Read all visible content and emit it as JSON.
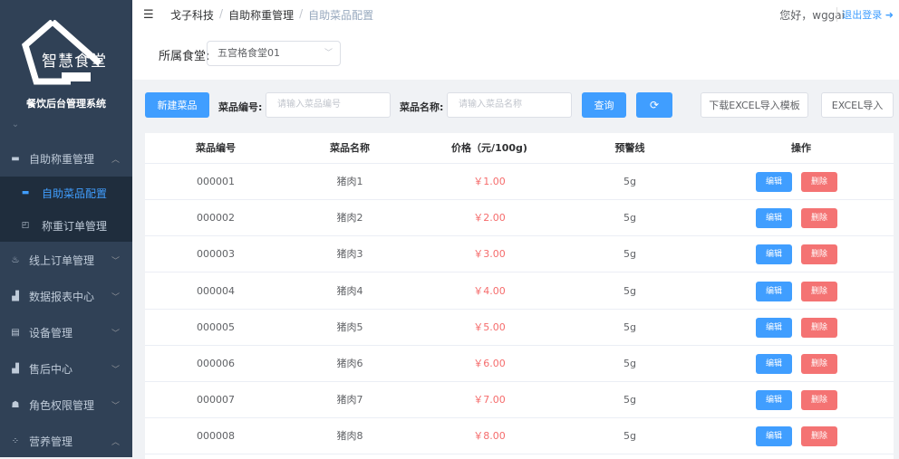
{
  "brand": {
    "logo_text": "智慧食堂",
    "system_title": "餐饮后台管理系统"
  },
  "colors": {
    "sidebar": "#304156",
    "submenu": "#1f2d3d",
    "primary": "#409eff",
    "danger": "#f56c6c",
    "danger_button": "#f47373"
  },
  "sidebar": {
    "items": [
      {
        "label": "自助称重管理",
        "icon": "scale-icon",
        "expanded": true
      },
      {
        "label": "线上订单管理",
        "icon": "food-icon"
      },
      {
        "label": "数据报表中心",
        "icon": "chart-icon"
      },
      {
        "label": "设备管理",
        "icon": "device-icon"
      },
      {
        "label": "售后中心",
        "icon": "chart-icon"
      },
      {
        "label": "角色权限管理",
        "icon": "users-icon"
      },
      {
        "label": "营养管理",
        "icon": "nutrition-icon",
        "expanded": true
      }
    ],
    "sub_items": [
      {
        "label": "自助菜品配置",
        "icon": "dish-icon",
        "active": true
      },
      {
        "label": "称重订单管理",
        "icon": "order-icon"
      }
    ]
  },
  "header": {
    "breadcrumb": [
      "戈子科技",
      "自助称重管理",
      "自助菜品配置"
    ],
    "greeting": "您好，wggai",
    "logout": "退出登录"
  },
  "canteen": {
    "label": "所属食堂:",
    "value": "五宫格食堂01"
  },
  "toolbar": {
    "new_label": "新建菜品",
    "code_label": "菜品编号:",
    "code_placeholder": "请输入菜品编号",
    "name_label": "菜品名称:",
    "name_placeholder": "请输入菜品名称",
    "query_label": "查询",
    "refresh_icon": "refresh-icon",
    "download_label": "下载EXCEL导入模板",
    "import_label": "EXCEL导入"
  },
  "table": {
    "columns": [
      "菜品编号",
      "菜品名称",
      "价格（元/100g)",
      "预警线",
      "操作"
    ],
    "edit_label": "编辑",
    "delete_label": "删除",
    "rows": [
      {
        "code": "000001",
        "name": "猪肉1",
        "price": "￥1.00",
        "warn": "5g"
      },
      {
        "code": "000002",
        "name": "猪肉2",
        "price": "￥2.00",
        "warn": "5g"
      },
      {
        "code": "000003",
        "name": "猪肉3",
        "price": "￥3.00",
        "warn": "5g"
      },
      {
        "code": "000004",
        "name": "猪肉4",
        "price": "￥4.00",
        "warn": "5g"
      },
      {
        "code": "000005",
        "name": "猪肉5",
        "price": "￥5.00",
        "warn": "5g"
      },
      {
        "code": "000006",
        "name": "猪肉6",
        "price": "￥6.00",
        "warn": "5g"
      },
      {
        "code": "000007",
        "name": "猪肉7",
        "price": "￥7.00",
        "warn": "5g"
      },
      {
        "code": "000008",
        "name": "猪肉8",
        "price": "￥8.00",
        "warn": "5g"
      }
    ]
  }
}
